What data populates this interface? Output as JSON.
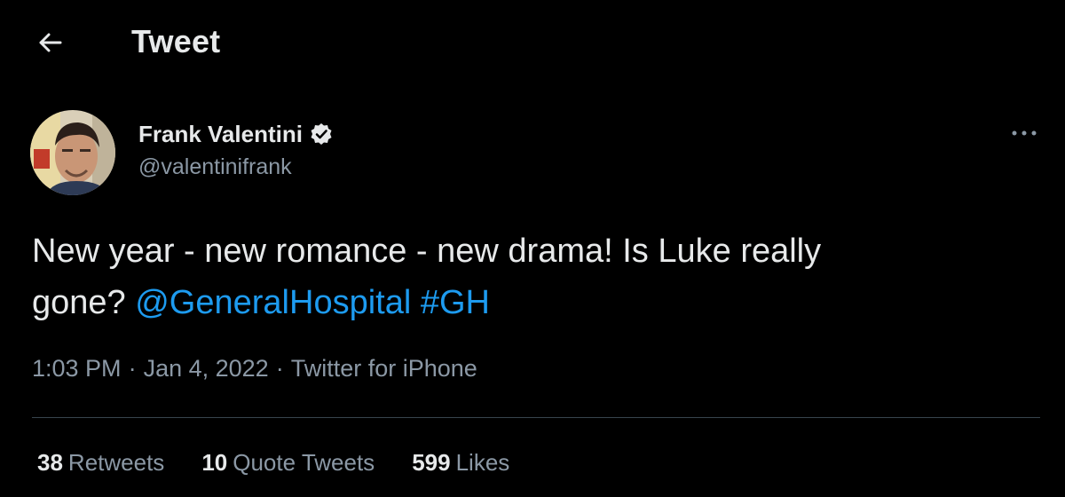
{
  "colors": {
    "background": "#000000",
    "text_primary": "#e7e9ea",
    "text_secondary": "#8b98a5",
    "link": "#1d9bf0",
    "divider": "#38444d"
  },
  "header": {
    "back_icon": "arrow-left-icon",
    "title": "Tweet"
  },
  "author": {
    "name": "Frank Valentini",
    "handle": "@valentinifrank",
    "verified": true,
    "verified_icon": "verified-badge-icon"
  },
  "more_icon": "more-horizontal-icon",
  "tweet": {
    "text_line1": "New year - new romance - new drama! Is Luke really",
    "text_line2_plain": "gone? ",
    "mention": "@GeneralHospital",
    "hashtag": "#GH"
  },
  "meta": {
    "time": "1:03 PM",
    "separator": "·",
    "date": "Jan 4, 2022",
    "source": "Twitter for iPhone"
  },
  "stats": {
    "retweets": {
      "count": "38",
      "label": "Retweets"
    },
    "quote_tweets": {
      "count": "10",
      "label": "Quote Tweets"
    },
    "likes": {
      "count": "599",
      "label": "Likes"
    }
  }
}
